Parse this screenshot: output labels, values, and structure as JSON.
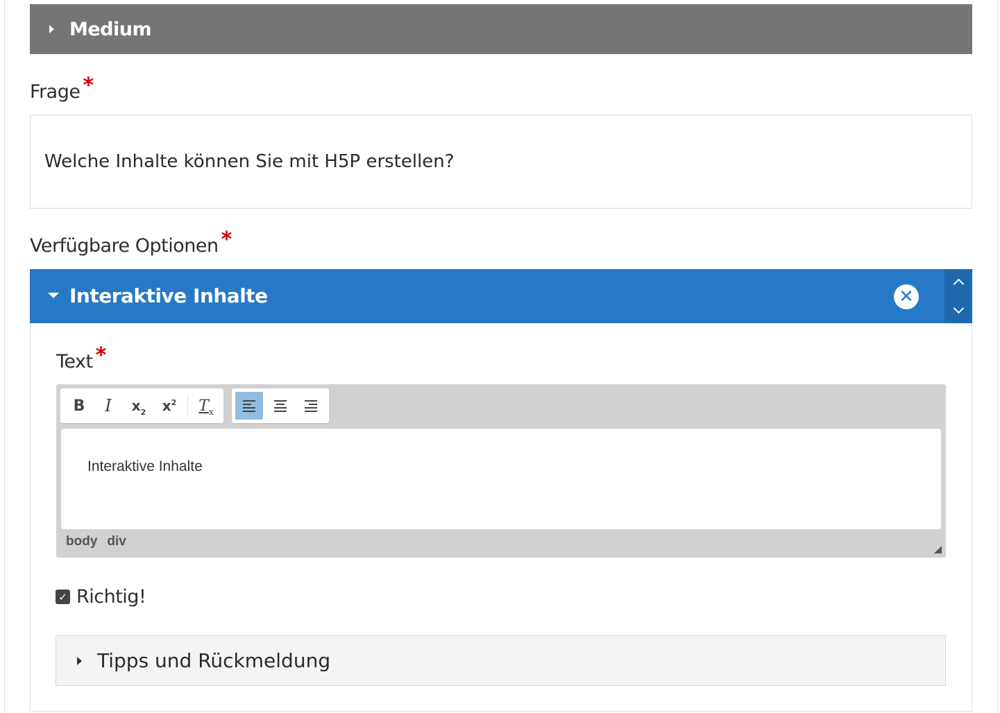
{
  "medium": {
    "label": "Medium"
  },
  "frage": {
    "label": "Frage",
    "required_mark": "*",
    "value": "Welche Inhalte können Sie mit H5P erstellen?"
  },
  "options": {
    "label": "Verfügbare Optionen",
    "required_mark": "*",
    "item": {
      "title": "Interaktive Inhalte",
      "remove_icon": "close-circle-icon",
      "move_up_icon": "chevron-up-icon",
      "move_down_icon": "chevron-down-icon",
      "text_field": {
        "label": "Text",
        "required_mark": "*",
        "value": "Interaktive Inhalte",
        "toolbar": {
          "bold": "B",
          "italic": "I",
          "subscript": "x",
          "subscript_mark": "2",
          "superscript": "x",
          "superscript_mark": "2",
          "remove_format": "T",
          "remove_format_mark": "x"
        },
        "path": [
          "body",
          "div"
        ]
      },
      "correct": {
        "label": "Richtig!",
        "checked": true
      },
      "tips": {
        "label": "Tipps und Rückmeldung"
      }
    }
  },
  "colors": {
    "header_blue": "#2579c6",
    "medium_gray": "#757477",
    "required_red": "#d60000",
    "active_align": "#92bce0"
  }
}
